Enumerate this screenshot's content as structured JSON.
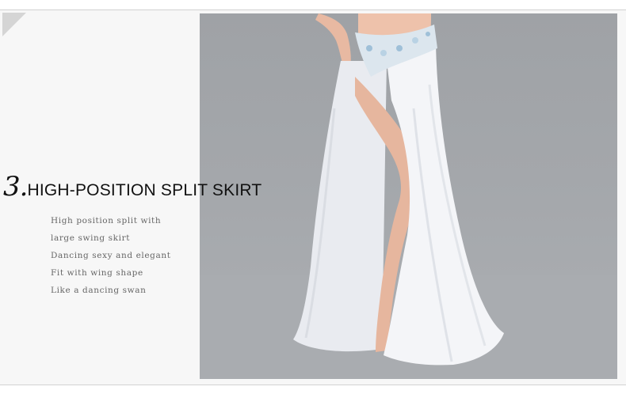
{
  "heading": {
    "number": "3.",
    "title": "HIGH-POSITION SPLIT SKIRT"
  },
  "description": {
    "lines": [
      "High position split with",
      "large swing skirt",
      "Dancing sexy and elegant",
      "Fit with wing shape",
      "Like a dancing swan"
    ]
  },
  "colors": {
    "photo_background": "#a4a7ab",
    "panel_background": "#f7f7f7",
    "skirt": "#f4f5f8",
    "heading_text": "#111111",
    "description_text": "#666666"
  }
}
